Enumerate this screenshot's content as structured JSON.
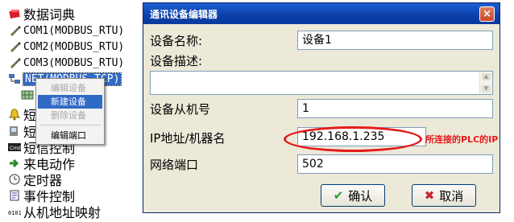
{
  "tree": {
    "items": [
      {
        "label": "数据词典",
        "icon": "red-gem-icon"
      },
      {
        "label": "COM1(MODBUS_RTU)",
        "icon": "pen-icon"
      },
      {
        "label": "COM2(MODBUS_RTU)",
        "icon": "pen-icon"
      },
      {
        "label": "COM3(MODBUS_RTU)",
        "icon": "pen-icon"
      },
      {
        "label": "NET(MODBUS_TCP)",
        "icon": "network-icon"
      },
      {
        "label": "短",
        "icon": "bell-icon"
      },
      {
        "label": "短",
        "icon": "sms-icon"
      },
      {
        "label": "短信控制",
        "icon": "cmd-icon"
      },
      {
        "label": "来电动作",
        "icon": "arrow-icon"
      },
      {
        "label": "定时器",
        "icon": "clock-icon"
      },
      {
        "label": "事件控制",
        "icon": "event-icon"
      },
      {
        "label": "从机地址映射",
        "icon": "binary-icon"
      }
    ]
  },
  "context_menu": {
    "items": [
      {
        "label": "编辑设备",
        "state": "disabled"
      },
      {
        "label": "新建设备",
        "state": "highlighted"
      },
      {
        "label": "删除设备",
        "state": "disabled"
      },
      {
        "label": "编辑端口",
        "state": "normal"
      }
    ]
  },
  "dialog": {
    "title": "通讯设备编辑器",
    "close_icon": "×",
    "fields": {
      "device_name": {
        "label": "设备名称:",
        "value": "设备1"
      },
      "device_desc": {
        "label": "设备描述:",
        "value": ""
      },
      "slave_id": {
        "label": "设备从机号",
        "value": "1"
      },
      "ip": {
        "label": "IP地址/机器名",
        "value": "192.168.1.235"
      },
      "port": {
        "label": "网络端口",
        "value": "502"
      }
    },
    "annotation": "所连接的PLC的IP",
    "ok": {
      "label": "确认",
      "icon": "✔"
    },
    "cancel": {
      "label": "取消",
      "icon": "✖"
    }
  },
  "colors": {
    "accent": "#3169c6",
    "annotation": "#e51a1a",
    "titlebar": "#0b3fa8"
  }
}
